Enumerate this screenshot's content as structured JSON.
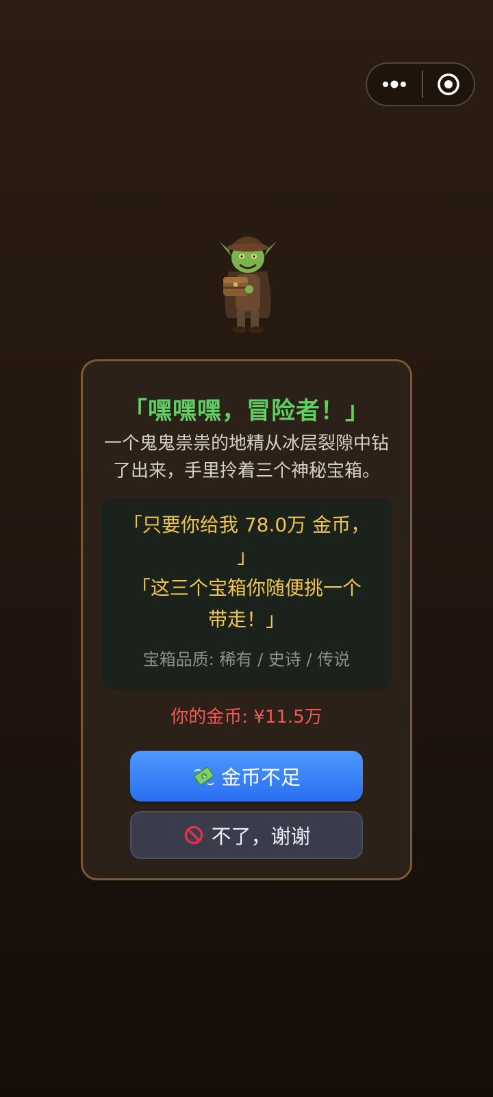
{
  "capsule": {
    "more_icon": "more-dots-icon",
    "close_icon": "target-circle-icon"
  },
  "goblin": {
    "icon": "goblin-with-chest-illustration"
  },
  "dialog": {
    "title": "「嘿嘿嘿，冒险者！」",
    "description_line1": "一个鬼鬼祟祟的地精从冰层裂隙中钻",
    "description_line2": "了出来，手里拎着三个神秘宝箱。",
    "offer_line1": "「只要你给我 78.0万 金币，",
    "offer_line2": "」",
    "offer_line3": "「这三个宝箱你随便挑一个",
    "offer_line4": "带走！」",
    "quality": "宝箱品质: 稀有 / 史诗 / 传说",
    "your_coins": "你的金币: ¥11.5万",
    "primary_button": "金币不足",
    "primary_icon": "money-with-wings-icon",
    "secondary_button": "不了，谢谢",
    "secondary_icon": "prohibited-icon"
  },
  "colors": {
    "title": "#5fd064",
    "offer": "#f0c54a",
    "coins_insufficient": "#f05a52",
    "primary_button": "#3a82f6",
    "card_border": "#7a5a34"
  }
}
